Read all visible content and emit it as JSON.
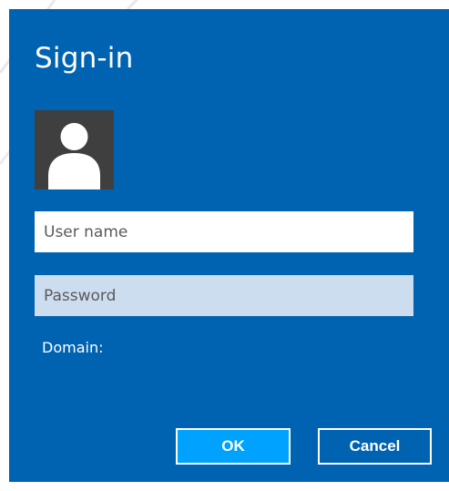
{
  "dialog": {
    "title": "Sign-in",
    "avatar_icon": "user-silhouette-icon",
    "username": {
      "value": "",
      "placeholder": "User name"
    },
    "password": {
      "value": "",
      "placeholder": "Password"
    },
    "domain_label": "Domain:",
    "ok_label": "OK",
    "cancel_label": "Cancel"
  },
  "colors": {
    "dialog_background": "#0063b1",
    "ok_button": "#00a2ff",
    "password_field": "#cdddf0",
    "avatar_background": "#3f3f3f"
  }
}
